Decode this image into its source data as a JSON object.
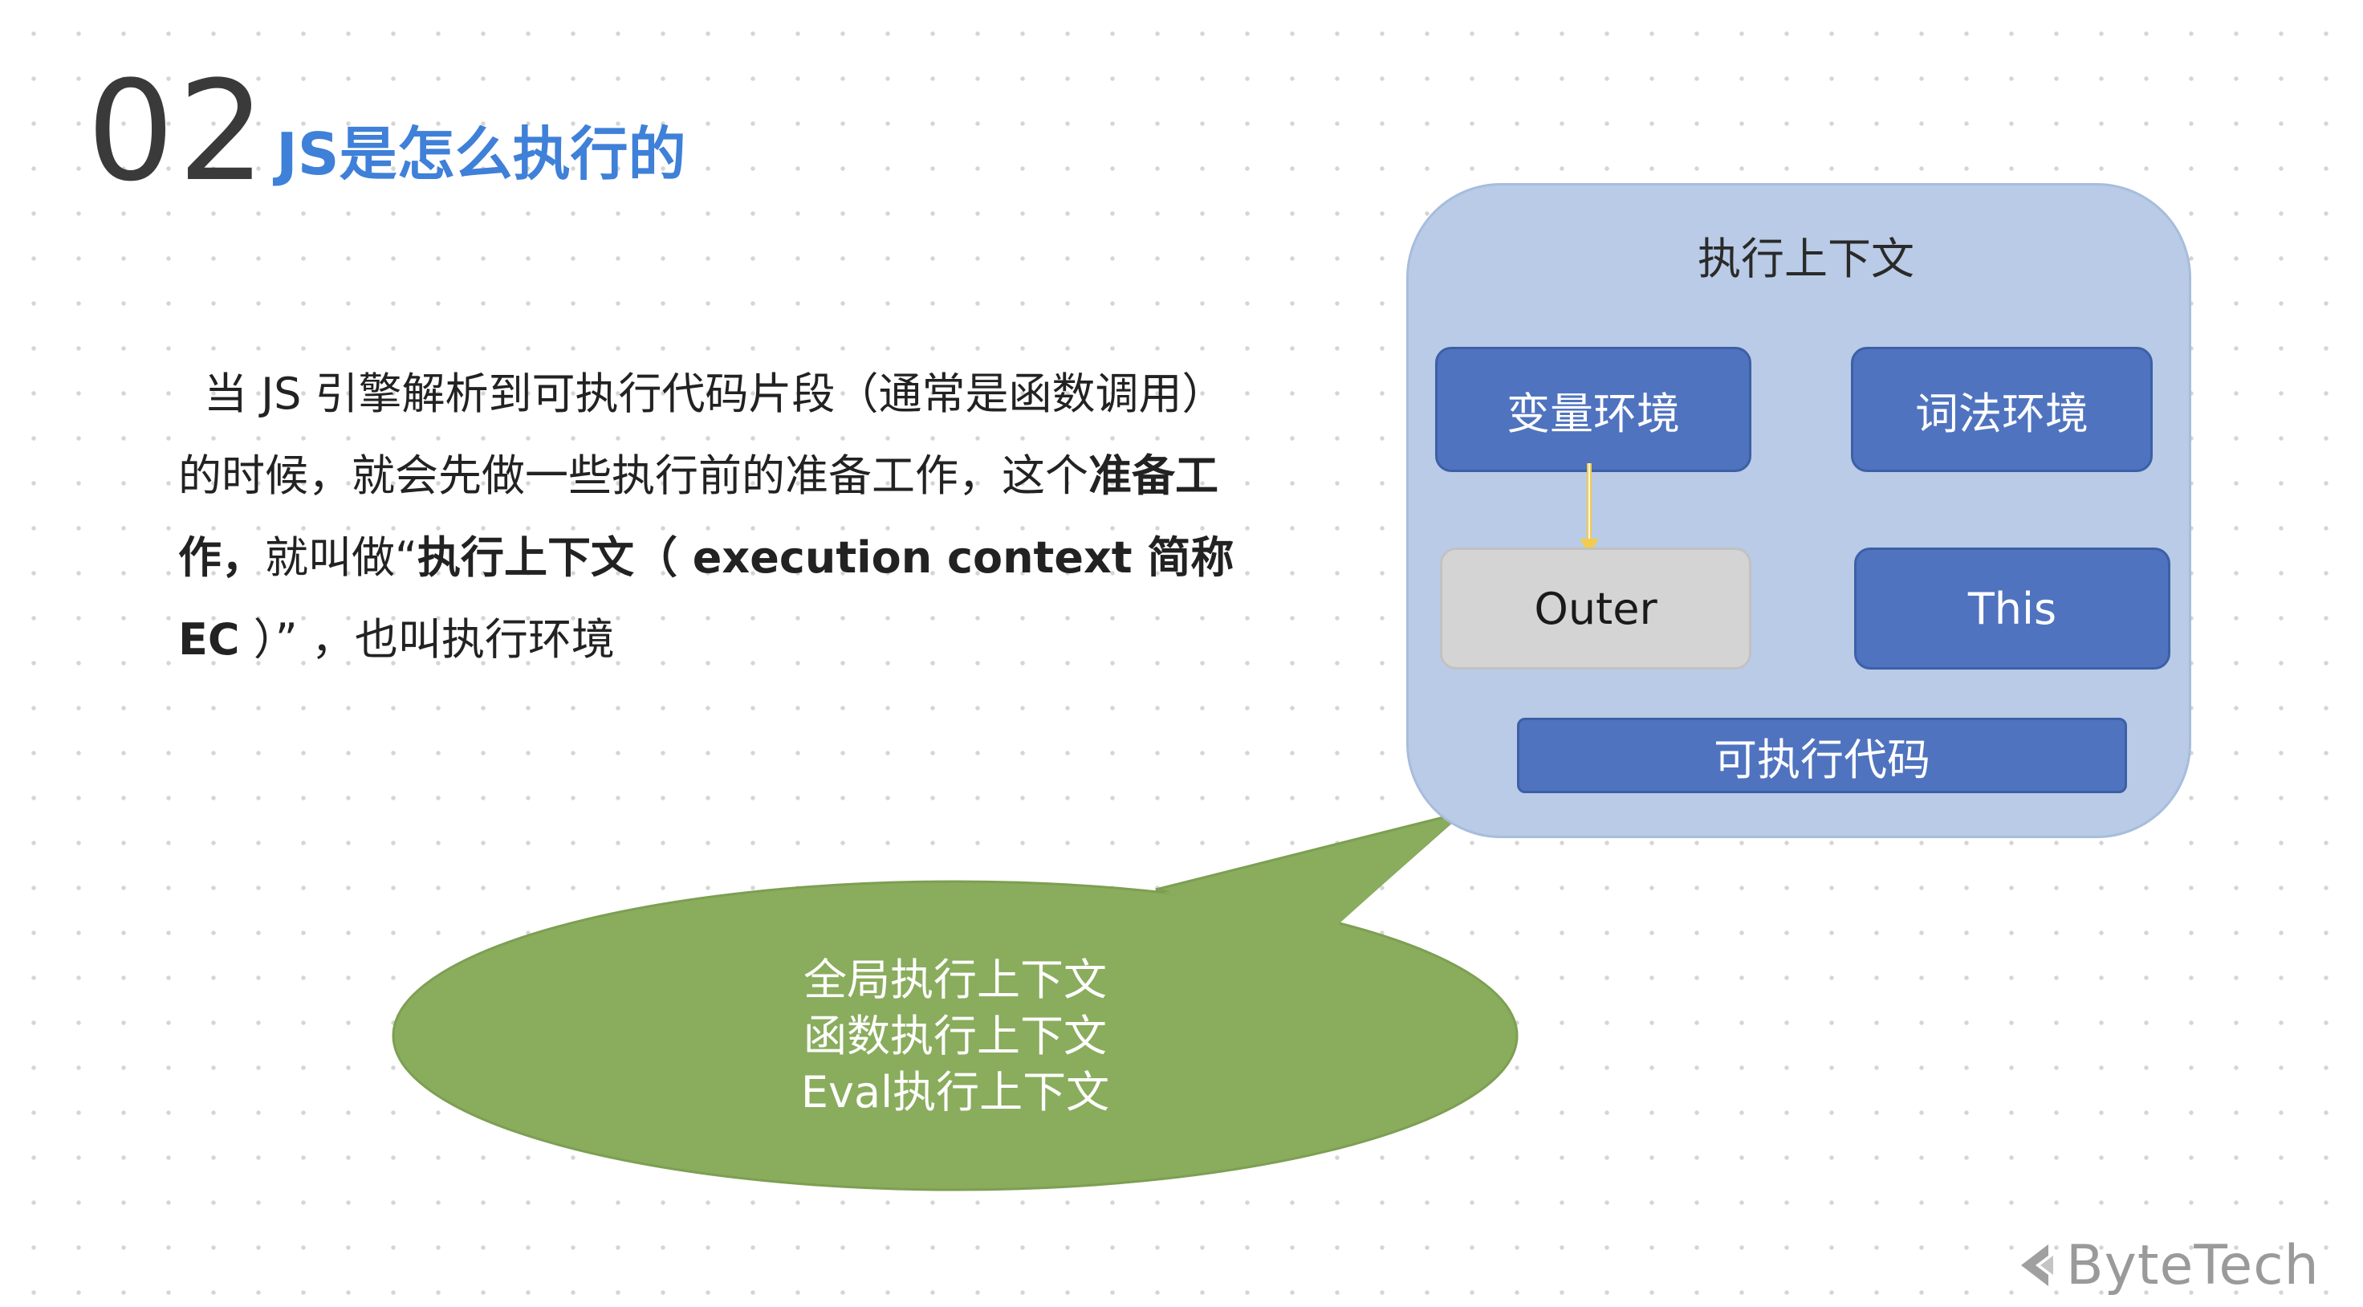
{
  "header": {
    "number": "02",
    "title": "JS是怎么执行的"
  },
  "body": {
    "line1": "当 JS 引擎解析到可执行代码片段（通常是函数调用）",
    "line2_normal": "的时候，就会先做一些执行前的准备工作，这个",
    "line2_bold": "准备工",
    "line3_bold_a": "作，",
    "line3_normal": "就叫做“",
    "line3_bold_b": "执行上下文（ execution context 简称",
    "line4_bold": "EC",
    "line4_normal": " ）” ，也叫执行环境"
  },
  "diagram": {
    "title": "执行上下文",
    "variable_env": "变量环境",
    "lexical_env": "词法环境",
    "outer": "Outer",
    "this": "This",
    "executable_code": "可执行代码"
  },
  "callout": {
    "line1": "全局执行上下文",
    "line2": "函数执行上下文",
    "line3": "Eval执行上下文"
  },
  "footer": {
    "brand": "ByteTech"
  },
  "colors": {
    "title_blue": "#3f80d8",
    "ec_box": "#b9cbe6",
    "node_blue": "#4f73bf",
    "node_gray": "#d4d4d4",
    "callout_green": "#8aac5d",
    "arrow_yellow": "#f2cc4e"
  }
}
